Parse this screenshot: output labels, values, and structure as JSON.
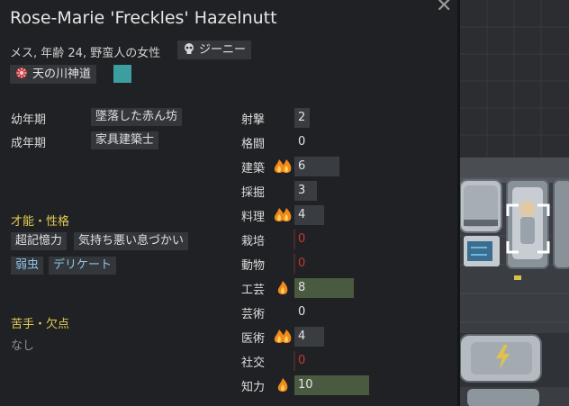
{
  "pawn": {
    "name": "Rose-Marie 'Freckles' Hazelnutt",
    "description": "メス, 年齢 24, 野蛮人の女性",
    "xenotype": "ジーニー",
    "ideoligion": "天の川神道",
    "ideo_color": "#3d9ea0"
  },
  "backstory": {
    "childhood_label": "幼年期",
    "childhood_value": "墜落した赤ん坊",
    "adulthood_label": "成年期",
    "adulthood_value": "家具建築士"
  },
  "traits_section": {
    "heading": "才能・性格",
    "traits": [
      "超記憶力",
      "気持ち悪い息づかい"
    ],
    "genes": [
      "弱虫",
      "デリケート"
    ]
  },
  "incapable_section": {
    "heading": "苦手・欠点",
    "value": "なし"
  },
  "skills": [
    {
      "name": "射撃",
      "level": "2",
      "passion": "none",
      "bar": 0.1,
      "disabled": false
    },
    {
      "name": "格闘",
      "level": "0",
      "passion": "none",
      "bar": 0.0,
      "disabled": false
    },
    {
      "name": "建築",
      "level": "6",
      "passion": "major",
      "bar": 0.3,
      "disabled": false
    },
    {
      "name": "採掘",
      "level": "3",
      "passion": "none",
      "bar": 0.15,
      "disabled": false
    },
    {
      "name": "料理",
      "level": "4",
      "passion": "major",
      "bar": 0.2,
      "disabled": false
    },
    {
      "name": "栽培",
      "level": "0",
      "passion": "none",
      "bar": 0.0,
      "disabled": true
    },
    {
      "name": "動物",
      "level": "0",
      "passion": "none",
      "bar": 0.0,
      "disabled": true
    },
    {
      "name": "工芸",
      "level": "8",
      "passion": "minor",
      "bar": 0.4,
      "disabled": false
    },
    {
      "name": "芸術",
      "level": "0",
      "passion": "none",
      "bar": 0.0,
      "disabled": false
    },
    {
      "name": "医術",
      "level": "4",
      "passion": "major",
      "bar": 0.2,
      "disabled": false
    },
    {
      "name": "社交",
      "level": "0",
      "passion": "none",
      "bar": 0.0,
      "disabled": true
    },
    {
      "name": "知力",
      "level": "10",
      "passion": "minor",
      "bar": 0.5,
      "disabled": false
    }
  ]
}
